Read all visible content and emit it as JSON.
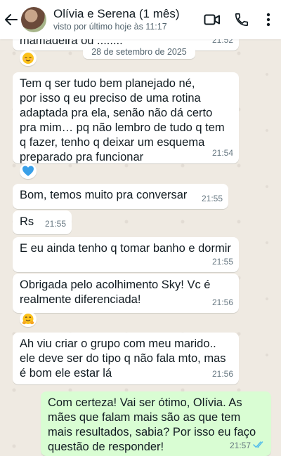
{
  "header": {
    "title": "Olívia e Serena (1 mês)",
    "subtitle": "visto por último hoje às 11:17"
  },
  "date_divider": "28 de setembro de 2025",
  "messages": [
    {
      "text": "mamadeira ou ........",
      "time": "21:52",
      "direction": "in"
    },
    {
      "text": "Tem q ser tudo bem planejado né,\npor isso q eu preciso de uma rotina\nadaptada pra ela, senão não dá certo\npra mim… pq não lembro de tudo q tem\nq fazer, tenho q deixar um esquema\npreparado pra funcionar",
      "time": "21:54",
      "direction": "in"
    },
    {
      "text": "Bom, temos muito pra conversar",
      "time": "21:55",
      "direction": "in"
    },
    {
      "text": "Rs",
      "time": "21:55",
      "direction": "in"
    },
    {
      "text": "E eu ainda tenho q tomar banho e dormir",
      "time": "21:55",
      "direction": "in"
    },
    {
      "text": "Obrigada pelo acolhimento Sky! Vc é\nrealmente diferenciada!",
      "time": "21:56",
      "direction": "in"
    },
    {
      "text": "Ah viu criar o grupo com meu marido..\nele deve ser do tipo q não fala mto, mas\né bom ele estar lá",
      "time": "21:56",
      "direction": "in"
    },
    {
      "text": "Com certeza! Vai ser ótimo, Olívia. As\nmães que falam mais são as que tem\nmais resultados, sabia? Por isso eu faço\nquestão de responder!",
      "time": "21:57",
      "direction": "out",
      "status": "read"
    }
  ],
  "reactions": [
    "relieved-face",
    "blue-heart",
    "hugging-face"
  ],
  "colors": {
    "wallpaper": "#efeae2",
    "incoming_bubble": "#ffffff",
    "outgoing_bubble": "#d9fdd3",
    "read_ticks": "#53bdeb"
  }
}
